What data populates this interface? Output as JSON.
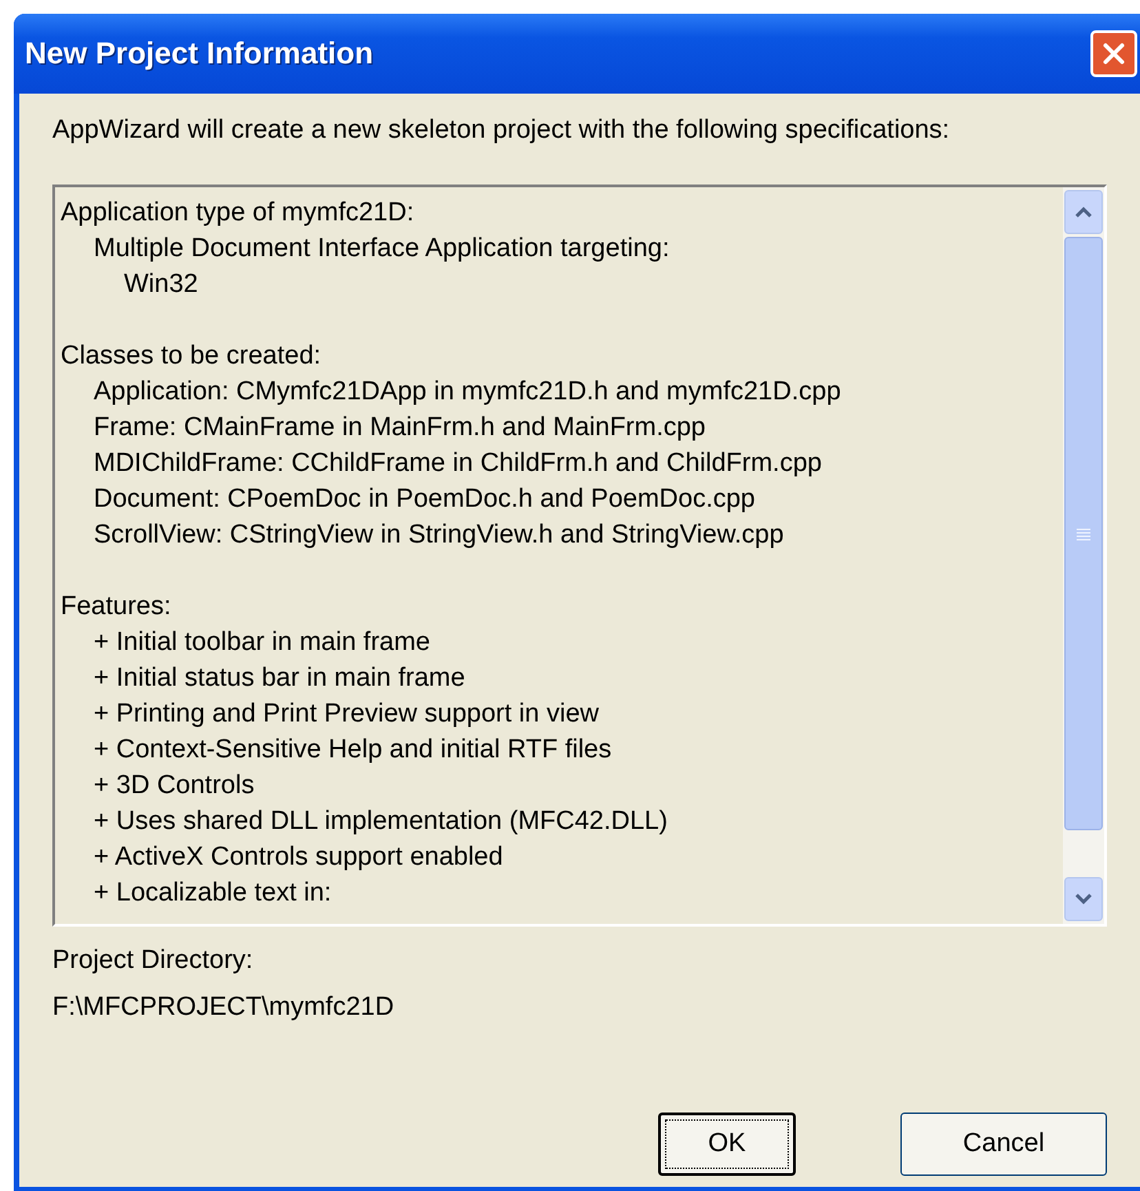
{
  "window": {
    "title": "New Project Information"
  },
  "intro": "AppWizard will create a new skeleton project with the following specifications:",
  "spec_sections": [
    {
      "text": "Application type of mymfc21D:",
      "children": [
        {
          "text": "Multiple Document Interface Application targeting:",
          "children": [
            {
              "text": "Win32"
            }
          ]
        }
      ]
    },
    {
      "text": "Classes to be created:",
      "children": [
        {
          "text": "Application: CMymfc21DApp in mymfc21D.h and mymfc21D.cpp"
        },
        {
          "text": "Frame: CMainFrame in MainFrm.h and MainFrm.cpp"
        },
        {
          "text": "MDIChildFrame: CChildFrame in ChildFrm.h and ChildFrm.cpp"
        },
        {
          "text": "Document: CPoemDoc in PoemDoc.h and PoemDoc.cpp"
        },
        {
          "text": "ScrollView: CStringView in StringView.h and StringView.cpp"
        }
      ]
    },
    {
      "text": "Features:",
      "children": [
        {
          "text": "+ Initial toolbar in main frame"
        },
        {
          "text": "+ Initial status bar in main frame"
        },
        {
          "text": "+ Printing and Print Preview support in view"
        },
        {
          "text": "+ Context-Sensitive Help and initial RTF files"
        },
        {
          "text": "+ 3D Controls"
        },
        {
          "text": "+ Uses shared DLL implementation (MFC42.DLL)"
        },
        {
          "text": "+ ActiveX Controls support enabled"
        },
        {
          "text": "+ Localizable text in:"
        }
      ]
    }
  ],
  "project_directory": {
    "label": "Project Directory:",
    "value": "F:\\MFCPROJECT\\mymfc21D"
  },
  "buttons": [
    {
      "label": "OK",
      "focused": true
    },
    {
      "label": "Cancel",
      "focused": false
    }
  ]
}
